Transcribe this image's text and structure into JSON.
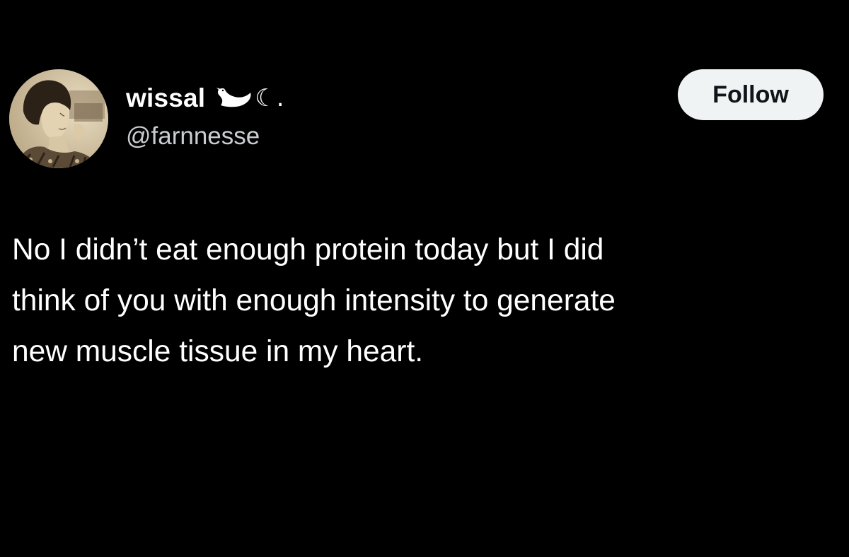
{
  "author": {
    "display_name": "wissal",
    "name_emoji": [
      "swan-icon",
      "crescent-moon-icon"
    ],
    "name_suffix": "☾.",
    "handle": "@farnnesse"
  },
  "follow_button": {
    "label": "Follow"
  },
  "tweet": {
    "lines": [
      "No I didn’t eat enough protein today but I did",
      "think of you with enough intensity to generate",
      "new muscle tissue in my heart."
    ]
  },
  "colors": {
    "background": "#000000",
    "text": "#ffffff",
    "handle": "#c9cdd1",
    "button_bg": "#eff3f4",
    "button_text": "#0f1419"
  }
}
